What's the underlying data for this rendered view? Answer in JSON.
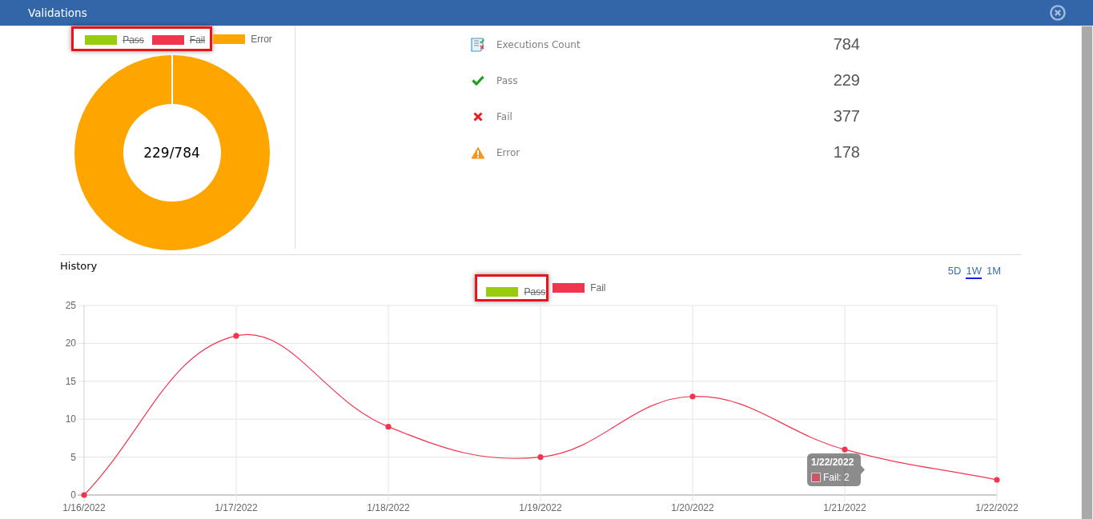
{
  "window": {
    "title": "Validations"
  },
  "summary_chart": {
    "legend": [
      {
        "label": "Pass",
        "color": "#99cc0f",
        "hidden": true,
        "highlighted": true
      },
      {
        "label": "Fail",
        "color": "#f2354f",
        "hidden": true,
        "highlighted": true
      },
      {
        "label": "Error",
        "color": "#ffa500",
        "hidden": false,
        "highlighted": false
      }
    ],
    "center_label": "229/784"
  },
  "stats": [
    {
      "kind": "count",
      "label": "Executions Count",
      "value": "784"
    },
    {
      "kind": "pass",
      "label": "Pass",
      "value": "229"
    },
    {
      "kind": "fail",
      "label": "Fail",
      "value": "377"
    },
    {
      "kind": "error",
      "label": "Error",
      "value": "178"
    }
  ],
  "history": {
    "title": "History",
    "periods": [
      {
        "label": "5D",
        "selected": false
      },
      {
        "label": "1W",
        "selected": true
      },
      {
        "label": "1M",
        "selected": false
      }
    ],
    "legend": [
      {
        "hidden": true,
        "highlighted": true
      },
      {
        "hidden": false,
        "highlighted": false
      }
    ],
    "chart_data": {
      "type": "line",
      "grid": true,
      "categories": [
        "1/16/2022",
        "1/17/2022",
        "1/18/2022",
        "1/19/2022",
        "1/20/2022",
        "1/21/2022",
        "1/22/2022"
      ],
      "series": [
        {
          "name": "Pass",
          "color": "#99cc0f",
          "values": [
            null,
            null,
            null,
            null,
            null,
            null,
            null
          ]
        },
        {
          "name": "Fail",
          "color": "#f2354f",
          "marker": true,
          "values": [
            0,
            21,
            9,
            5,
            13,
            6,
            2
          ]
        }
      ],
      "ylim": [
        0,
        25
      ],
      "yticks": [
        0,
        5,
        10,
        15,
        20,
        25
      ]
    },
    "tooltip": {
      "title": "1/22/2022",
      "label": "Fail: 2"
    }
  }
}
